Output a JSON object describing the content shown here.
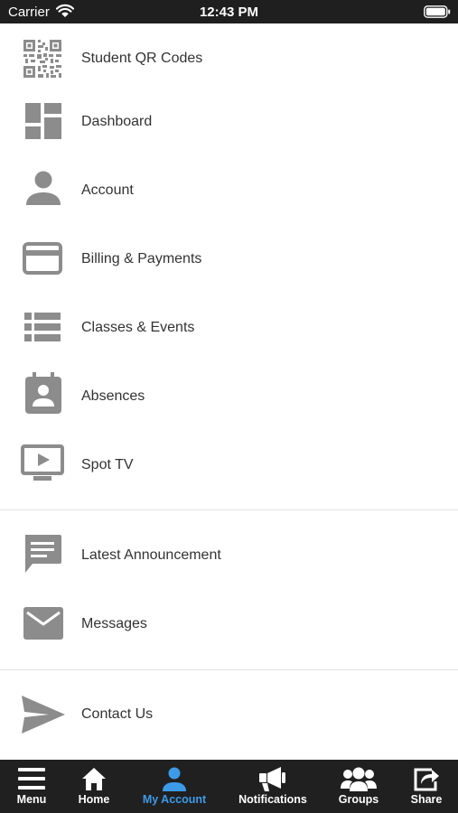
{
  "status_bar": {
    "carrier": "Carrier",
    "time": "12:43 PM"
  },
  "menu": {
    "items": [
      {
        "label": "Student QR Codes",
        "icon": "qr-code-icon"
      },
      {
        "label": "Dashboard",
        "icon": "dashboard-icon"
      },
      {
        "label": "Account",
        "icon": "person-icon"
      },
      {
        "label": "Billing & Payments",
        "icon": "credit-card-icon"
      },
      {
        "label": "Classes & Events",
        "icon": "list-icon"
      },
      {
        "label": "Absences",
        "icon": "calendar-person-icon"
      },
      {
        "label": "Spot TV",
        "icon": "tv-play-icon"
      },
      {
        "label": "Latest Announcement",
        "icon": "chat-icon"
      },
      {
        "label": "Messages",
        "icon": "envelope-icon"
      },
      {
        "label": "Contact Us",
        "icon": "paper-plane-icon"
      }
    ]
  },
  "tab_bar": {
    "active_tab": "My Account",
    "active_color": "#3d9ae8",
    "tabs": [
      {
        "label": "Menu",
        "icon": "hamburger-icon"
      },
      {
        "label": "Home",
        "icon": "home-icon"
      },
      {
        "label": "My Account",
        "icon": "person-icon"
      },
      {
        "label": "Notifications",
        "icon": "megaphone-icon"
      },
      {
        "label": "Groups",
        "icon": "group-icon"
      },
      {
        "label": "Share",
        "icon": "share-icon"
      }
    ]
  }
}
